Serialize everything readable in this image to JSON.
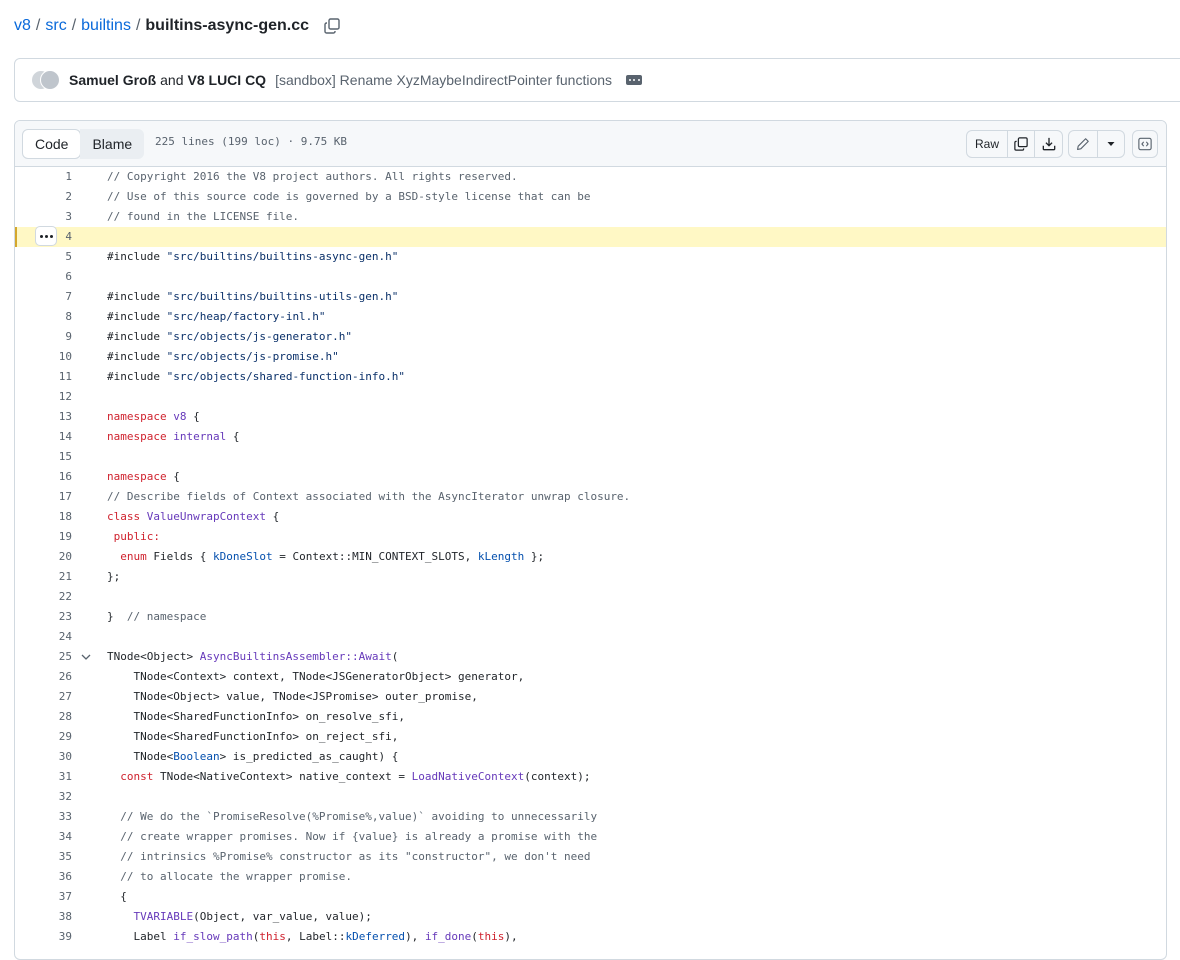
{
  "breadcrumb": {
    "items": [
      "v8",
      "src",
      "builtins"
    ],
    "separator": "/",
    "file": "builtins-async-gen.cc"
  },
  "commit": {
    "author1": "Samuel Groß",
    "and": "and",
    "author2": "V8 LUCI CQ",
    "message": "[sandbox] Rename XyzMaybeIndirectPointer functions"
  },
  "file_header": {
    "tab_code": "Code",
    "tab_blame": "Blame",
    "info": "225 lines (199 loc) · 9.75 KB",
    "raw_label": "Raw"
  },
  "code": {
    "highlighted_line": 4,
    "folded_line": 25,
    "lines": [
      {
        "n": "1",
        "html": "<span class=\"cm\">// Copyright 2016 the V8 project authors. All rights reserved.</span>"
      },
      {
        "n": "2",
        "html": "<span class=\"cm\">// Use of this source code is governed by a BSD-style license that can be</span>"
      },
      {
        "n": "3",
        "html": "<span class=\"cm\">// found in the LICENSE file.</span>"
      },
      {
        "n": "4",
        "html": ""
      },
      {
        "n": "5",
        "html": "#include <span class=\"str\">\"src/builtins/builtins-async-gen.h\"</span>"
      },
      {
        "n": "6",
        "html": ""
      },
      {
        "n": "7",
        "html": "#include <span class=\"str\">\"src/builtins/builtins-utils-gen.h\"</span>"
      },
      {
        "n": "8",
        "html": "#include <span class=\"str\">\"src/heap/factory-inl.h\"</span>"
      },
      {
        "n": "9",
        "html": "#include <span class=\"str\">\"src/objects/js-generator.h\"</span>"
      },
      {
        "n": "10",
        "html": "#include <span class=\"str\">\"src/objects/js-promise.h\"</span>"
      },
      {
        "n": "11",
        "html": "#include <span class=\"str\">\"src/objects/shared-function-info.h\"</span>"
      },
      {
        "n": "12",
        "html": ""
      },
      {
        "n": "13",
        "html": "<span class=\"kw\">namespace</span> <span class=\"fn\">v8</span> {"
      },
      {
        "n": "14",
        "html": "<span class=\"kw\">namespace</span> <span class=\"fn\">internal</span> {"
      },
      {
        "n": "15",
        "html": ""
      },
      {
        "n": "16",
        "html": "<span class=\"kw\">namespace</span> {"
      },
      {
        "n": "17",
        "html": "<span class=\"cm\">// Describe fields of Context associated with the AsyncIterator unwrap closure.</span>"
      },
      {
        "n": "18",
        "html": "<span class=\"kw\">class</span> <span class=\"fn\">ValueUnwrapContext</span> {"
      },
      {
        "n": "19",
        "html": " <span class=\"kw\">public:</span>"
      },
      {
        "n": "20",
        "html": "  <span class=\"kw\">enum</span> Fields { <span class=\"bl\">kDoneSlot</span> = Context::MIN_CONTEXT_SLOTS, <span class=\"bl\">kLength</span> };"
      },
      {
        "n": "21",
        "html": "};"
      },
      {
        "n": "22",
        "html": ""
      },
      {
        "n": "23",
        "html": "}  <span class=\"cm\">// namespace</span>"
      },
      {
        "n": "24",
        "html": ""
      },
      {
        "n": "25",
        "html": "TNode&lt;Object&gt; <span class=\"fn\">AsyncBuiltinsAssembler::Await</span>("
      },
      {
        "n": "26",
        "html": "    TNode&lt;Context&gt; context, TNode&lt;JSGeneratorObject&gt; generator,"
      },
      {
        "n": "27",
        "html": "    TNode&lt;Object&gt; value, TNode&lt;JSPromise&gt; outer_promise,"
      },
      {
        "n": "28",
        "html": "    TNode&lt;SharedFunctionInfo&gt; on_resolve_sfi,"
      },
      {
        "n": "29",
        "html": "    TNode&lt;SharedFunctionInfo&gt; on_reject_sfi,"
      },
      {
        "n": "30",
        "html": "    TNode&lt;<span class=\"bl\">Boolean</span>&gt; is_predicted_as_caught) {"
      },
      {
        "n": "31",
        "html": "  <span class=\"kw\">const</span> TNode&lt;NativeContext&gt; native_context = <span class=\"fn\">LoadNativeContext</span>(context);"
      },
      {
        "n": "32",
        "html": ""
      },
      {
        "n": "33",
        "html": "  <span class=\"cm\">// We do the `PromiseResolve(%Promise%,value)` avoiding to unnecessarily</span>"
      },
      {
        "n": "34",
        "html": "  <span class=\"cm\">// create wrapper promises. Now if {value} is already a promise with the</span>"
      },
      {
        "n": "35",
        "html": "  <span class=\"cm\">// intrinsics %Promise% constructor as its \"constructor\", we don't need</span>"
      },
      {
        "n": "36",
        "html": "  <span class=\"cm\">// to allocate the wrapper promise.</span>"
      },
      {
        "n": "37",
        "html": "  {"
      },
      {
        "n": "38",
        "html": "    <span class=\"fn\">TVARIABLE</span>(Object, var_value, value);"
      },
      {
        "n": "39",
        "html": "    Label <span class=\"fn\">if_slow_path</span>(<span class=\"kw\">this</span>, Label::<span class=\"bl\">kDeferred</span>), <span class=\"fn\">if_done</span>(<span class=\"kw\">this</span>),"
      }
    ]
  },
  "colors": {
    "link": "#0969da",
    "keyword": "#cf222e",
    "function": "#6639ba",
    "string": "#0a3069",
    "comment": "#59636e",
    "highlight": "#fff8c5"
  },
  "icons": [
    "copy-icon",
    "kebab-icon",
    "copy-raw-icon",
    "download-icon",
    "pencil-icon",
    "triangle-down-icon",
    "symbols-icon",
    "chevron-down-icon"
  ]
}
